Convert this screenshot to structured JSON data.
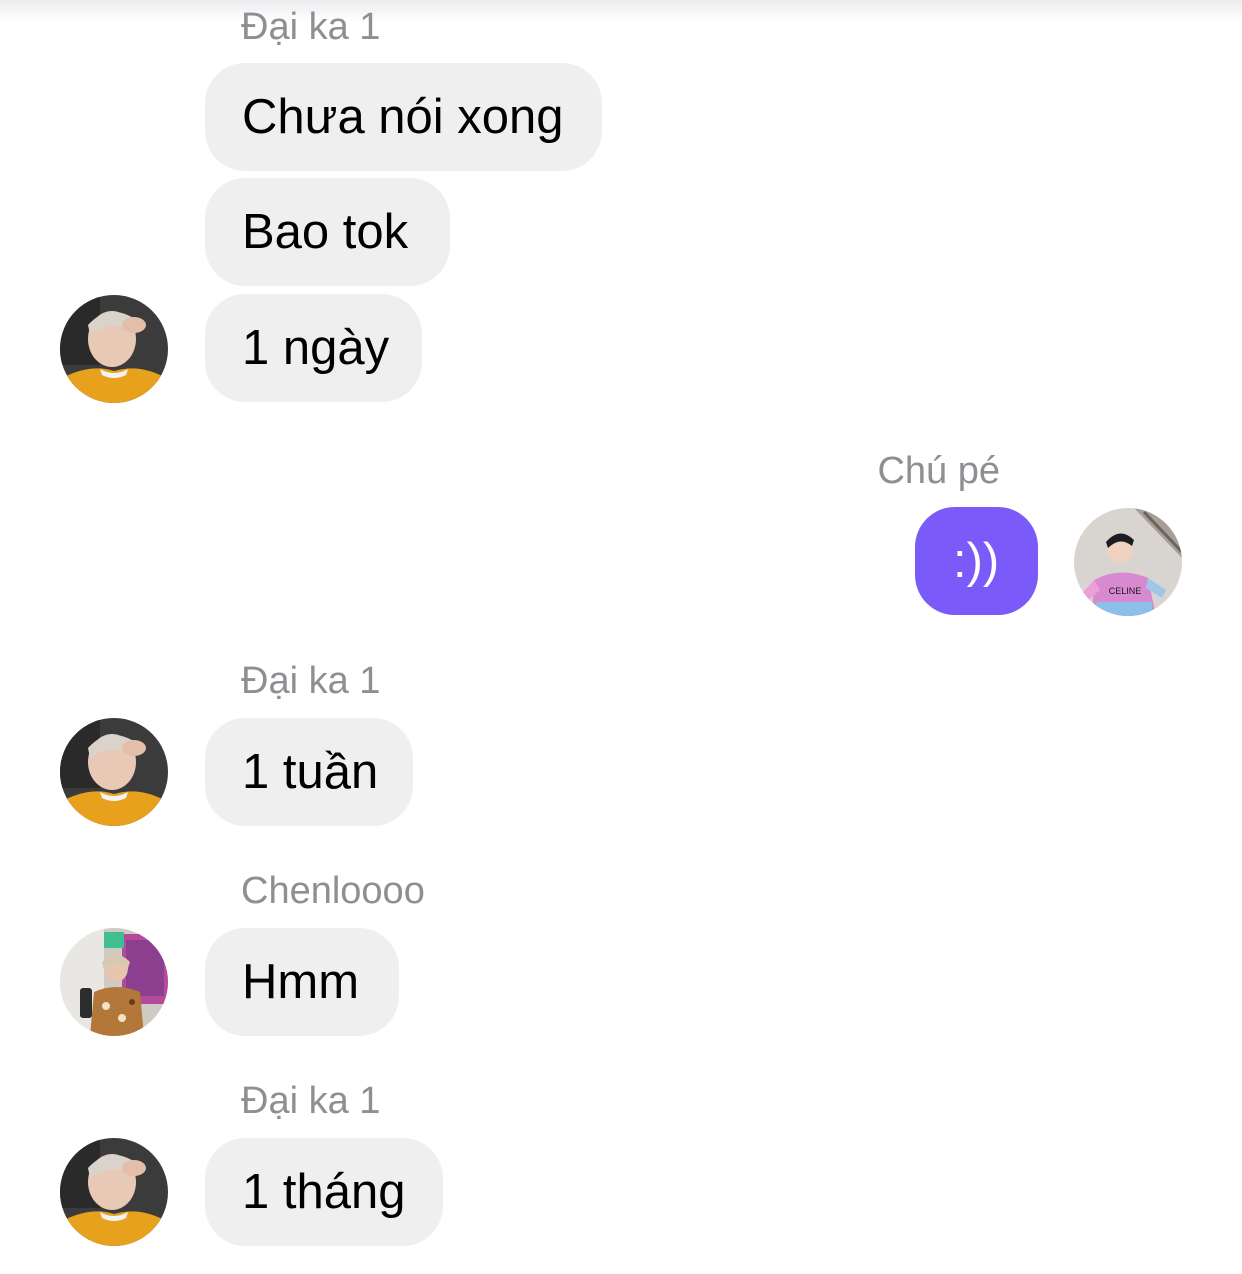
{
  "messages": [
    {
      "sender": "Đại ka 1"
    },
    {
      "text": "Chưa nói xong"
    },
    {
      "text": "Bao tok"
    },
    {
      "text": "1 ngày"
    },
    {
      "sender": "Chú pé"
    },
    {
      "text": ":))"
    },
    {
      "sender": "Đại ka 1"
    },
    {
      "text": "1 tuần"
    },
    {
      "sender": "Chenloooo"
    },
    {
      "text": "Hmm"
    },
    {
      "sender": "Đại ka 1"
    },
    {
      "text": "1 tháng"
    }
  ],
  "shirt_label": "CELINE",
  "colors": {
    "incoming_bubble": "#efeff0",
    "outgoing_bubble": "#7a5af8",
    "sender_name": "#8e8e93"
  }
}
